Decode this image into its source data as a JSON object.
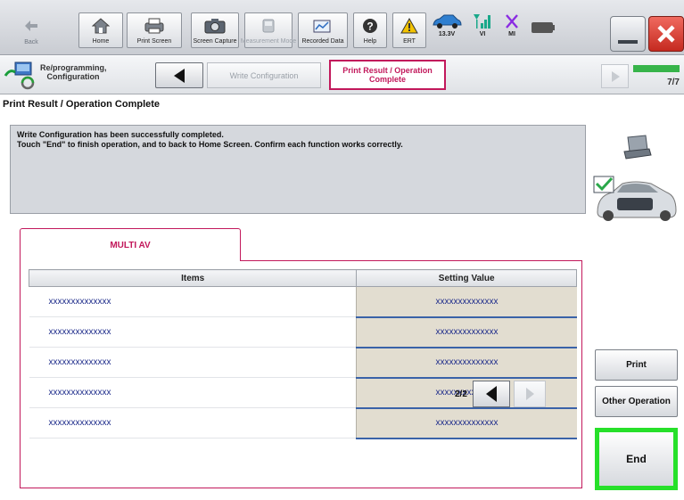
{
  "toolbar": {
    "back_label": "Back",
    "home_label": "Home",
    "print_screen_label": "Print Screen",
    "screen_capture_label": "Screen Capture",
    "measurement_mode_label": "Measurement Mode",
    "recorded_data_label": "Recorded Data",
    "help_label": "Help",
    "ert_label": "ERT",
    "voltage_label": "13.3V",
    "vi_label": "VI",
    "mi_label": "MI"
  },
  "stepbar": {
    "reprogramming_label": "Re/programming, Configuration",
    "write_config_label": "Write Configuration",
    "current_step_label": "Print Result / Operation Complete",
    "progress_label": "7/7",
    "progress_fraction": 1.0
  },
  "main": {
    "page_title": "Print Result / Operation Complete",
    "message_line1": "Write Configuration has been successfully completed.",
    "message_line2": "Touch \"End\" to finish operation, and to back to Home Screen. Confirm each function works correctly.",
    "tab_label": "MULTI AV"
  },
  "table": {
    "columns": [
      "Items",
      "Setting Value"
    ],
    "rows": [
      [
        "xxxxxxxxxxxxxx",
        "xxxxxxxxxxxxxx"
      ],
      [
        "xxxxxxxxxxxxxx",
        "xxxxxxxxxxxxxx"
      ],
      [
        "xxxxxxxxxxxxxx",
        "xxxxxxxxxxxxxx"
      ],
      [
        "xxxxxxxxxxxxxx",
        "xxxxxxxxxxxxxx"
      ],
      [
        "xxxxxxxxxxxxxx",
        "xxxxxxxxxxxxxx"
      ]
    ]
  },
  "pager": {
    "label": "2/2"
  },
  "buttons": {
    "print": "Print",
    "other_operation": "Other Operation",
    "end": "End"
  },
  "colors": {
    "accent": "#c2185b",
    "end_highlight": "#27e02a",
    "progress": "#37b44a",
    "value_cell": "#e2ddd0",
    "close": "#d33a2f"
  }
}
